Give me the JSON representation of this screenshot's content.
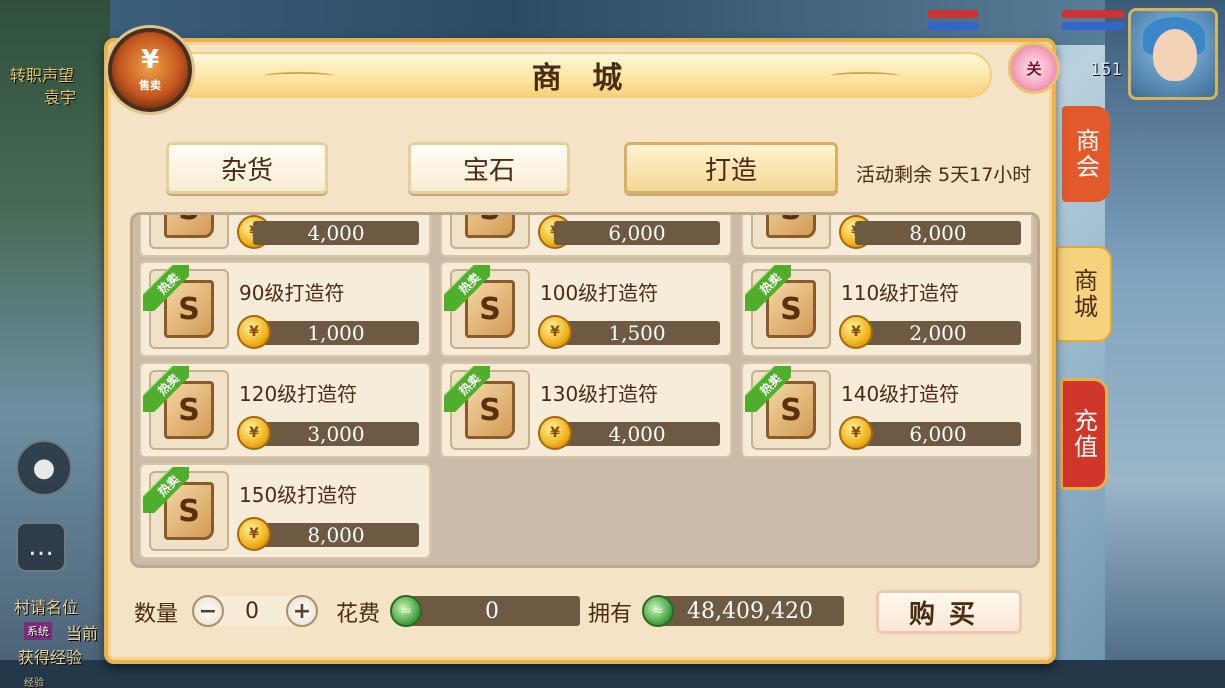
{
  "hud": {
    "left_text_1": "转职声望",
    "left_text_2": "袁宇",
    "left_text_3": "村请名位",
    "left_text_4": "当前",
    "left_text_5": "获得经验",
    "sys_tag": "系统",
    "level": "151",
    "exp_label": "经验"
  },
  "shop": {
    "title": "商 城",
    "sell_badge_symbol": "¥",
    "sell_badge_label": "售卖",
    "close_label": "关",
    "tabs": [
      {
        "label": "杂货",
        "active": false
      },
      {
        "label": "宝石",
        "active": false
      },
      {
        "label": "打造",
        "active": true
      }
    ],
    "event_remaining": "活动剩余 5天17小时",
    "hot_tag": "热卖",
    "partial_prices": [
      "4,000",
      "6,000",
      "8,000"
    ],
    "items": [
      {
        "name": "90级打造符",
        "price": "1,000"
      },
      {
        "name": "100级打造符",
        "price": "1,500"
      },
      {
        "name": "110级打造符",
        "price": "2,000"
      },
      {
        "name": "120级打造符",
        "price": "3,000"
      },
      {
        "name": "130级打造符",
        "price": "4,000"
      },
      {
        "name": "140级打造符",
        "price": "6,000"
      },
      {
        "name": "150级打造符",
        "price": "8,000"
      }
    ],
    "quantity_label": "数量",
    "quantity_value": "0",
    "minus_label": "−",
    "plus_label": "+",
    "cost_label": "花费",
    "cost_value": "0",
    "owned_label": "拥有",
    "owned_value": "48,409,420",
    "buy_label": "购买"
  },
  "side_tabs": [
    {
      "label": "商会",
      "color": "#e25a2c"
    },
    {
      "label": "商城",
      "color": "#f6d27d"
    },
    {
      "label": "充值",
      "color": "#d1362a"
    }
  ],
  "colors": {
    "panel_bg": "#f4e3c6",
    "panel_border": "#e9b04b",
    "price_bar": "#6e5a42",
    "hot_tag": "#4fae2c"
  }
}
